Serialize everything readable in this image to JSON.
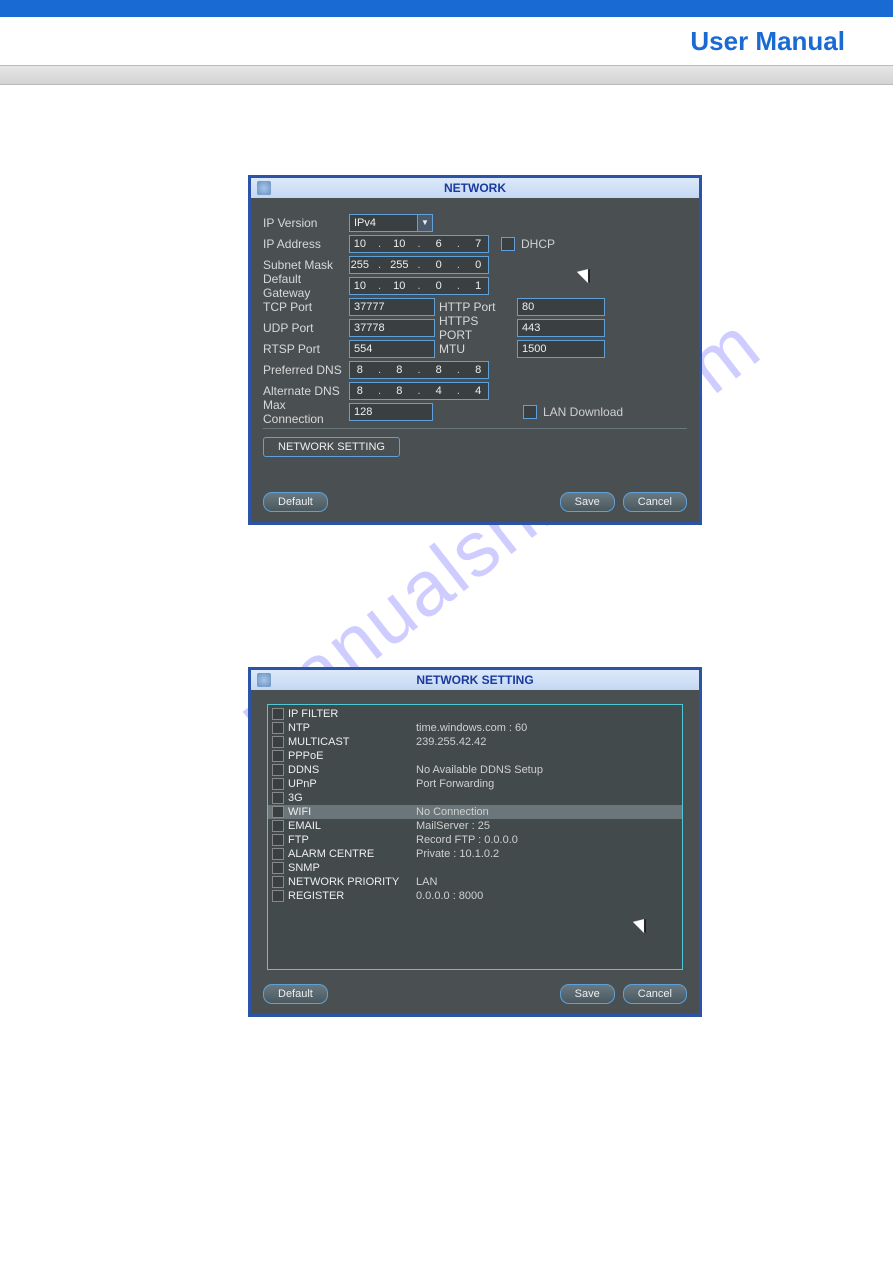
{
  "header": {
    "title": "User Manual"
  },
  "watermark": "manualshive.com",
  "dialog1": {
    "title": "NETWORK",
    "labels": {
      "ip_version": "IP Version",
      "ip_address": "IP Address",
      "subnet_mask": "Subnet Mask",
      "default_gateway": "Default Gateway",
      "tcp_port": "TCP Port",
      "udp_port": "UDP Port",
      "rtsp_port": "RTSP Port",
      "http_port": "HTTP Port",
      "https_port": "HTTPS PORT",
      "mtu": "MTU",
      "preferred_dns": "Preferred DNS",
      "alternate_dns": "Alternate DNS",
      "max_connection": "Max Connection",
      "dhcp": "DHCP",
      "lan_download": "LAN Download",
      "network_setting": "NETWORK SETTING"
    },
    "values": {
      "ip_version": "IPv4",
      "ip_address": [
        "10",
        "10",
        "6",
        "7"
      ],
      "subnet_mask": [
        "255",
        "255",
        "0",
        "0"
      ],
      "default_gateway": [
        "10",
        "10",
        "0",
        "1"
      ],
      "tcp_port": "37777",
      "udp_port": "37778",
      "rtsp_port": "554",
      "http_port": "80",
      "https_port": "443",
      "mtu": "1500",
      "preferred_dns": [
        "8",
        "8",
        "8",
        "8"
      ],
      "alternate_dns": [
        "8",
        "8",
        "4",
        "4"
      ],
      "max_connection": "128"
    },
    "buttons": {
      "default": "Default",
      "save": "Save",
      "cancel": "Cancel"
    }
  },
  "dialog2": {
    "title": "NETWORK SETTING",
    "items": [
      {
        "name": "IP FILTER",
        "value": ""
      },
      {
        "name": "NTP",
        "value": "time.windows.com : 60"
      },
      {
        "name": "MULTICAST",
        "value": "239.255.42.42"
      },
      {
        "name": "PPPoE",
        "value": ""
      },
      {
        "name": "DDNS",
        "value": "No Available DDNS Setup"
      },
      {
        "name": "UPnP",
        "value": "Port Forwarding"
      },
      {
        "name": "3G",
        "value": ""
      },
      {
        "name": "WIFI",
        "value": "No Connection",
        "selected": true
      },
      {
        "name": "EMAIL",
        "value": "MailServer : 25"
      },
      {
        "name": "FTP",
        "value": "Record FTP : 0.0.0.0"
      },
      {
        "name": "ALARM CENTRE",
        "value": "Private : 10.1.0.2"
      },
      {
        "name": "SNMP",
        "value": ""
      },
      {
        "name": "NETWORK PRIORITY",
        "value": "LAN"
      },
      {
        "name": "REGISTER",
        "value": "0.0.0.0 : 8000"
      }
    ],
    "buttons": {
      "default": "Default",
      "save": "Save",
      "cancel": "Cancel"
    }
  }
}
